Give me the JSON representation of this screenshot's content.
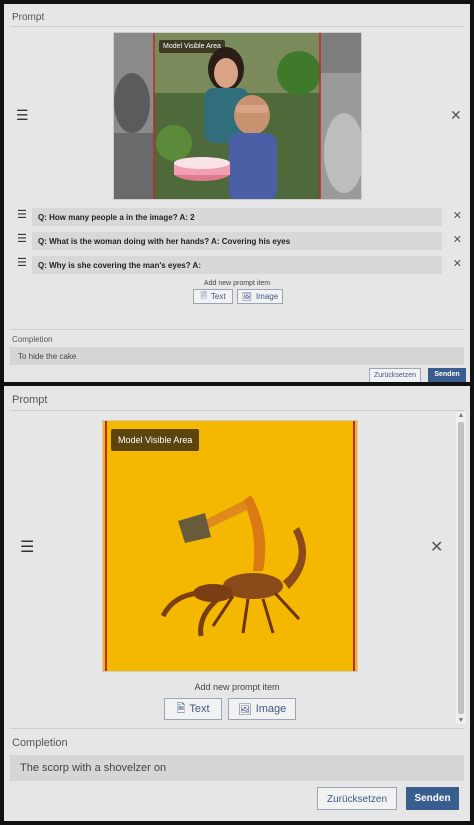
{
  "top_panel": {
    "prompt_label": "Prompt",
    "image_overlay_label": "Model Visible Area",
    "prompt_items": [
      {
        "text": "Q: How many people a in the image? A: 2"
      },
      {
        "text": "Q: What is the woman doing with her hands? A: Covering his eyes"
      },
      {
        "text": "Q: Why is she covering the man's eyes? A:"
      }
    ],
    "add_prompt_label": "Add new prompt item",
    "text_button": "Text",
    "image_button": "Image",
    "completion_label": "Completion",
    "completion_value": "To hide the cake",
    "reset_button": "Zurücksetzen",
    "send_button": "Senden"
  },
  "bottom_panel": {
    "prompt_label": "Prompt",
    "image_overlay_label": "Model Visible Area",
    "add_prompt_label": "Add new prompt item",
    "text_button": "Text",
    "image_button": "Image",
    "completion_label": "Completion",
    "completion_value": "The scorp with a shovelzer on",
    "reset_button": "Zurücksetzen",
    "send_button": "Senden"
  },
  "colors": {
    "send_button": "#3a5d8f",
    "yellow_background": "#f5b800",
    "panel_bg": "#e6e6e6"
  },
  "icons": [
    "drag-handle-icon",
    "close-icon",
    "text-doc-icon",
    "image-icon"
  ]
}
